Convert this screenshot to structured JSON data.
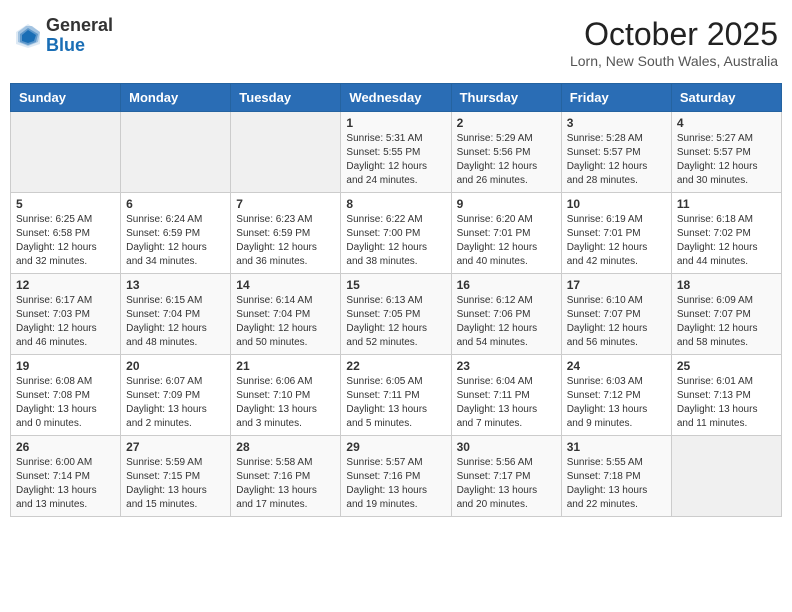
{
  "header": {
    "logo": {
      "line1": "General",
      "line2": "Blue"
    },
    "month": "October 2025",
    "location": "Lorn, New South Wales, Australia"
  },
  "weekdays": [
    "Sunday",
    "Monday",
    "Tuesday",
    "Wednesday",
    "Thursday",
    "Friday",
    "Saturday"
  ],
  "weeks": [
    [
      {
        "day": "",
        "content": ""
      },
      {
        "day": "",
        "content": ""
      },
      {
        "day": "",
        "content": ""
      },
      {
        "day": "1",
        "content": "Sunrise: 5:31 AM\nSunset: 5:55 PM\nDaylight: 12 hours\nand 24 minutes."
      },
      {
        "day": "2",
        "content": "Sunrise: 5:29 AM\nSunset: 5:56 PM\nDaylight: 12 hours\nand 26 minutes."
      },
      {
        "day": "3",
        "content": "Sunrise: 5:28 AM\nSunset: 5:57 PM\nDaylight: 12 hours\nand 28 minutes."
      },
      {
        "day": "4",
        "content": "Sunrise: 5:27 AM\nSunset: 5:57 PM\nDaylight: 12 hours\nand 30 minutes."
      }
    ],
    [
      {
        "day": "5",
        "content": "Sunrise: 6:25 AM\nSunset: 6:58 PM\nDaylight: 12 hours\nand 32 minutes."
      },
      {
        "day": "6",
        "content": "Sunrise: 6:24 AM\nSunset: 6:59 PM\nDaylight: 12 hours\nand 34 minutes."
      },
      {
        "day": "7",
        "content": "Sunrise: 6:23 AM\nSunset: 6:59 PM\nDaylight: 12 hours\nand 36 minutes."
      },
      {
        "day": "8",
        "content": "Sunrise: 6:22 AM\nSunset: 7:00 PM\nDaylight: 12 hours\nand 38 minutes."
      },
      {
        "day": "9",
        "content": "Sunrise: 6:20 AM\nSunset: 7:01 PM\nDaylight: 12 hours\nand 40 minutes."
      },
      {
        "day": "10",
        "content": "Sunrise: 6:19 AM\nSunset: 7:01 PM\nDaylight: 12 hours\nand 42 minutes."
      },
      {
        "day": "11",
        "content": "Sunrise: 6:18 AM\nSunset: 7:02 PM\nDaylight: 12 hours\nand 44 minutes."
      }
    ],
    [
      {
        "day": "12",
        "content": "Sunrise: 6:17 AM\nSunset: 7:03 PM\nDaylight: 12 hours\nand 46 minutes."
      },
      {
        "day": "13",
        "content": "Sunrise: 6:15 AM\nSunset: 7:04 PM\nDaylight: 12 hours\nand 48 minutes."
      },
      {
        "day": "14",
        "content": "Sunrise: 6:14 AM\nSunset: 7:04 PM\nDaylight: 12 hours\nand 50 minutes."
      },
      {
        "day": "15",
        "content": "Sunrise: 6:13 AM\nSunset: 7:05 PM\nDaylight: 12 hours\nand 52 minutes."
      },
      {
        "day": "16",
        "content": "Sunrise: 6:12 AM\nSunset: 7:06 PM\nDaylight: 12 hours\nand 54 minutes."
      },
      {
        "day": "17",
        "content": "Sunrise: 6:10 AM\nSunset: 7:07 PM\nDaylight: 12 hours\nand 56 minutes."
      },
      {
        "day": "18",
        "content": "Sunrise: 6:09 AM\nSunset: 7:07 PM\nDaylight: 12 hours\nand 58 minutes."
      }
    ],
    [
      {
        "day": "19",
        "content": "Sunrise: 6:08 AM\nSunset: 7:08 PM\nDaylight: 13 hours\nand 0 minutes."
      },
      {
        "day": "20",
        "content": "Sunrise: 6:07 AM\nSunset: 7:09 PM\nDaylight: 13 hours\nand 2 minutes."
      },
      {
        "day": "21",
        "content": "Sunrise: 6:06 AM\nSunset: 7:10 PM\nDaylight: 13 hours\nand 3 minutes."
      },
      {
        "day": "22",
        "content": "Sunrise: 6:05 AM\nSunset: 7:11 PM\nDaylight: 13 hours\nand 5 minutes."
      },
      {
        "day": "23",
        "content": "Sunrise: 6:04 AM\nSunset: 7:11 PM\nDaylight: 13 hours\nand 7 minutes."
      },
      {
        "day": "24",
        "content": "Sunrise: 6:03 AM\nSunset: 7:12 PM\nDaylight: 13 hours\nand 9 minutes."
      },
      {
        "day": "25",
        "content": "Sunrise: 6:01 AM\nSunset: 7:13 PM\nDaylight: 13 hours\nand 11 minutes."
      }
    ],
    [
      {
        "day": "26",
        "content": "Sunrise: 6:00 AM\nSunset: 7:14 PM\nDaylight: 13 hours\nand 13 minutes."
      },
      {
        "day": "27",
        "content": "Sunrise: 5:59 AM\nSunset: 7:15 PM\nDaylight: 13 hours\nand 15 minutes."
      },
      {
        "day": "28",
        "content": "Sunrise: 5:58 AM\nSunset: 7:16 PM\nDaylight: 13 hours\nand 17 minutes."
      },
      {
        "day": "29",
        "content": "Sunrise: 5:57 AM\nSunset: 7:16 PM\nDaylight: 13 hours\nand 19 minutes."
      },
      {
        "day": "30",
        "content": "Sunrise: 5:56 AM\nSunset: 7:17 PM\nDaylight: 13 hours\nand 20 minutes."
      },
      {
        "day": "31",
        "content": "Sunrise: 5:55 AM\nSunset: 7:18 PM\nDaylight: 13 hours\nand 22 minutes."
      },
      {
        "day": "",
        "content": ""
      }
    ]
  ]
}
